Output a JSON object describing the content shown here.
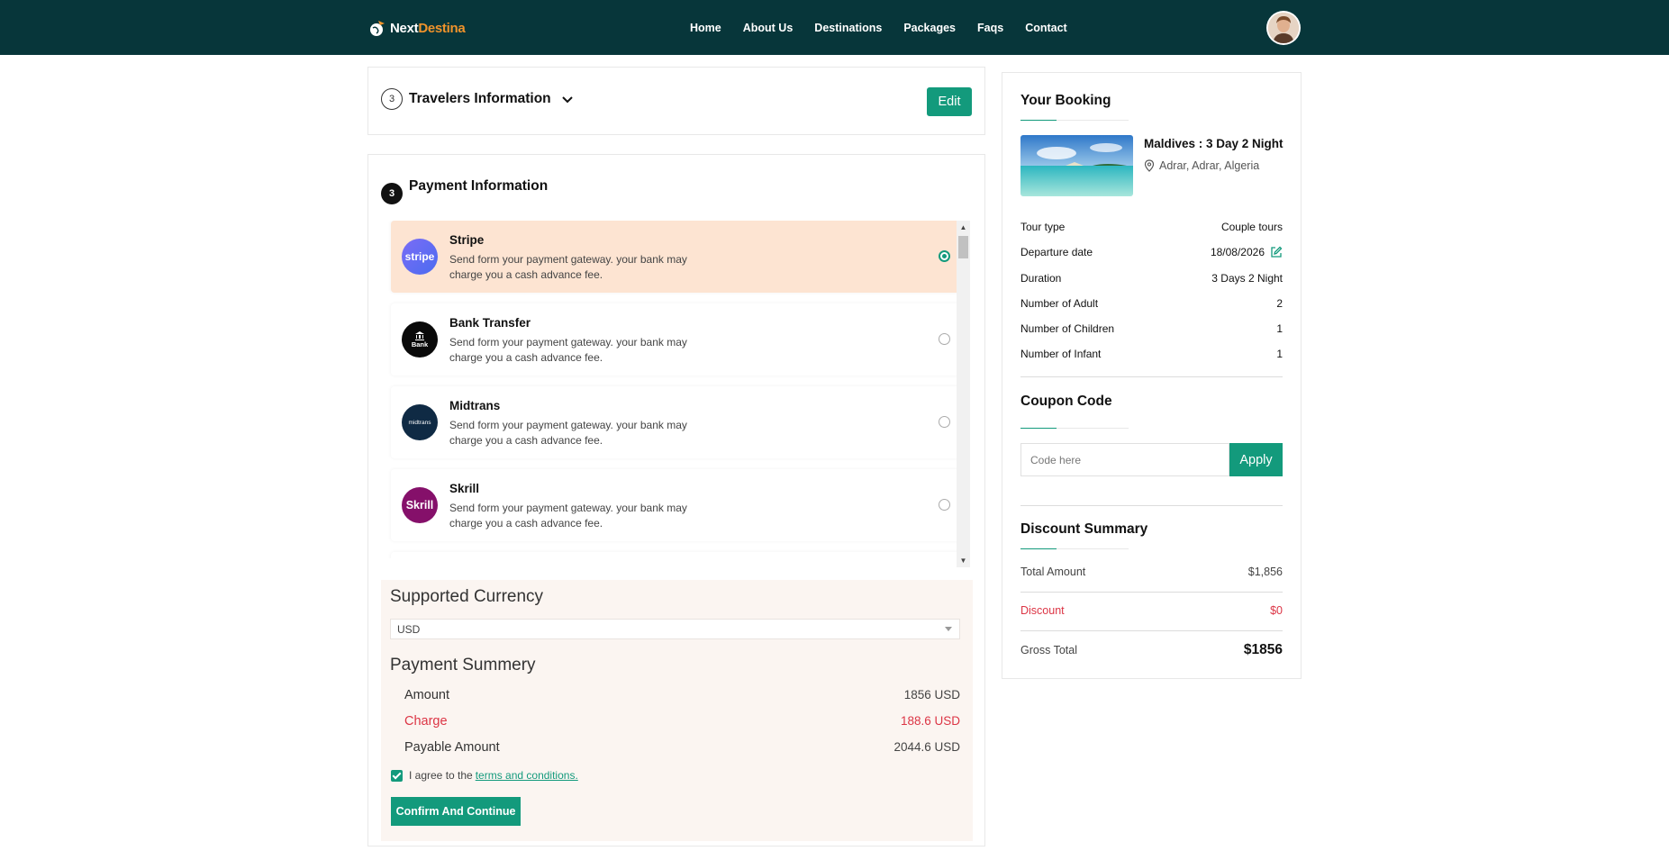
{
  "brand": {
    "name_part1": "Next",
    "name_part2": "Destina"
  },
  "nav": {
    "items": [
      "Home",
      "About Us",
      "Destinations",
      "Packages",
      "Faqs",
      "Contact"
    ]
  },
  "colors": {
    "navbar": "#07363a",
    "accent": "#139a7c",
    "accent_orange": "#f0932b",
    "danger": "#dc3545",
    "active_method_bg": "#fde4d2"
  },
  "travelers": {
    "step": "3",
    "title": "Travelers Information",
    "edit_label": "Edit"
  },
  "payment": {
    "step": "3",
    "title": "Payment Information",
    "methods": [
      {
        "name": "Stripe",
        "logo_text": "stripe",
        "desc": "Send form your payment gateway. your bank may charge you a cash advance fee.",
        "selected": true
      },
      {
        "name": "Bank Transfer",
        "logo_text": "Bank",
        "desc": "Send form your payment gateway. your bank may charge you a cash advance fee.",
        "selected": false
      },
      {
        "name": "Midtrans",
        "logo_text": "midtrans",
        "desc": "Send form your payment gateway. your bank may charge you a cash advance fee.",
        "selected": false
      },
      {
        "name": "Skrill",
        "logo_text": "Skrill",
        "desc": "Send form your payment gateway. your bank may charge you a cash advance fee.",
        "selected": false
      }
    ],
    "currency_heading": "Supported Currency",
    "currency_value": "USD",
    "summary_heading": "Payment Summery",
    "summary": {
      "amount_label": "Amount",
      "amount_value": "1856 USD",
      "charge_label": "Charge",
      "charge_value": "188.6 USD",
      "payable_label": "Payable Amount",
      "payable_value": "2044.6 USD"
    },
    "agree_text": "I agree to the",
    "agree_link": "terms and conditions.",
    "confirm_label": "Confirm And Continue"
  },
  "booking": {
    "heading": "Your Booking",
    "tour_name": "Maldives : 3 Day 2 Night",
    "tour_location": "Adrar, Adrar, Algeria",
    "details": [
      {
        "label": "Tour type",
        "value": "Couple tours"
      },
      {
        "label": "Departure date",
        "value": "18/08/2026"
      },
      {
        "label": "Duration",
        "value": "3 Days 2 Night"
      },
      {
        "label": "Number of Adult",
        "value": "2"
      },
      {
        "label": "Number of Children",
        "value": "1"
      },
      {
        "label": "Number of Infant",
        "value": "1"
      }
    ],
    "coupon_heading": "Coupon Code",
    "coupon_placeholder": "Code here",
    "apply_label": "Apply",
    "discount_heading": "Discount Summary",
    "total_label": "Total Amount",
    "total_value": "$1,856",
    "discount_label": "Discount",
    "discount_value": "$0",
    "gross_label": "Gross Total",
    "gross_value": "$1856"
  }
}
